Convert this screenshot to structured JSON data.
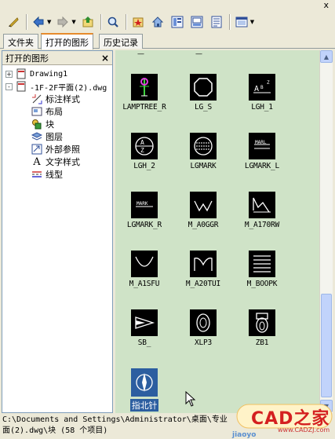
{
  "window": {
    "close_glyph": "x"
  },
  "toolbar": {
    "buttons": [
      "load-icon",
      "back-icon",
      "forward-icon",
      "up-icon",
      "search-icon",
      "favorites-icon",
      "home-icon",
      "tree-toggle-icon",
      "preview-icon",
      "description-icon",
      "views-icon"
    ]
  },
  "tabs": [
    {
      "label": "文件夹",
      "active": false
    },
    {
      "label": "打开的图形",
      "active": true
    },
    {
      "label": "历史记录",
      "active": false
    }
  ],
  "tree": {
    "header": "打开的图形",
    "close": "×",
    "nodes": [
      {
        "label": "Drawing1",
        "expander": "+"
      },
      {
        "label": "-1F-2F平面(2).dwg",
        "expander": "-"
      },
      {
        "label": "标注样式"
      },
      {
        "label": "布局"
      },
      {
        "label": "块"
      },
      {
        "label": "图层"
      },
      {
        "label": "外部参照"
      },
      {
        "label": "文字样式"
      },
      {
        "label": "线型"
      }
    ]
  },
  "items": [
    {
      "label": "LAMPTREE_R",
      "icon": "lamp-tree-icon"
    },
    {
      "label": "LG_S",
      "icon": "octagon-icon"
    },
    {
      "label": "LGH_1",
      "icon": "lgh1-icon"
    },
    {
      "label": "LGH_2",
      "icon": "circle-az-icon"
    },
    {
      "label": "LGMARK",
      "icon": "lgmark-icon"
    },
    {
      "label": "LGMARK_L",
      "icon": "mark-l-icon"
    },
    {
      "label": "LGMARK_R",
      "icon": "mark-r-icon"
    },
    {
      "label": "M_A0GGR",
      "icon": "zigzag-icon"
    },
    {
      "label": "M_A170RW",
      "icon": "waveform-icon"
    },
    {
      "label": "M_A1SFU",
      "icon": "v-curve-icon"
    },
    {
      "label": "M_A20TUI",
      "icon": "m-curve-icon"
    },
    {
      "label": "M_BOOPK",
      "icon": "lines-icon"
    },
    {
      "label": "SB_",
      "icon": "triangle-icon"
    },
    {
      "label": "XLP3",
      "icon": "ellipse-icon"
    },
    {
      "label": "ZB1",
      "icon": "toilet-icon"
    },
    {
      "label": "指北针",
      "icon": "compass-icon"
    }
  ],
  "status": {
    "line1": "C:\\Documents and Settings\\Administrator\\桌面\\专业",
    "line2": "面(2).dwg\\块  (58  个项目)"
  },
  "watermark": {
    "brand": "CAD之家",
    "url": "www.CADZJ.com",
    "site": "jiaoyo"
  },
  "colors": {
    "content_bg": "#cfe3c7",
    "chrome": "#ece9d8",
    "tab_active_accent": "#e68b2c"
  }
}
